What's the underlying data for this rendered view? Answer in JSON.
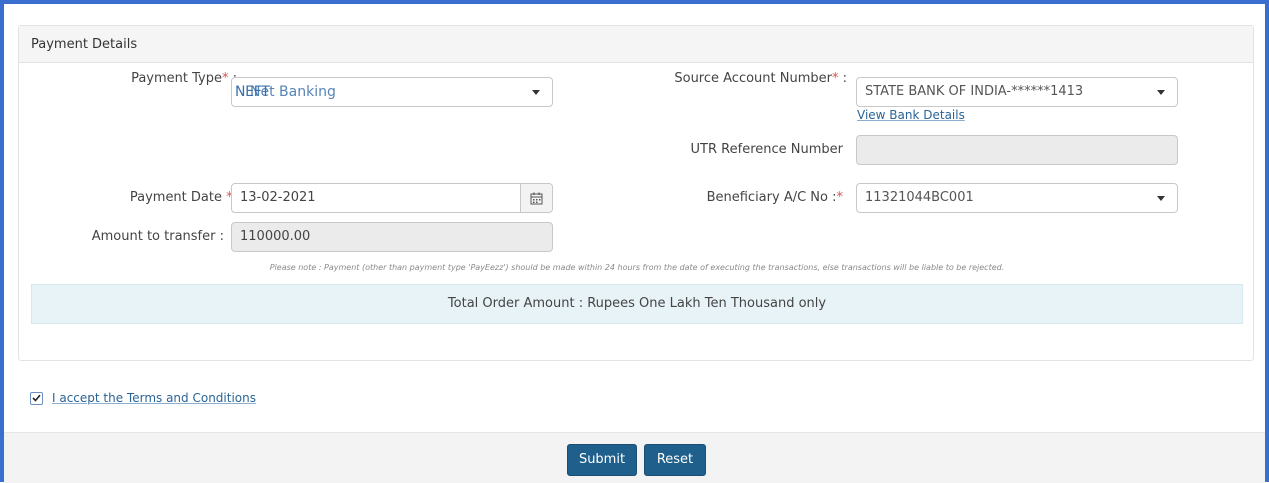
{
  "panel": {
    "title": "Payment Details",
    "payment_type": {
      "label": "Payment Type",
      "required_mark": "*",
      "colon": " :",
      "value": "NEFT",
      "overlay_text": "Net Banking"
    },
    "source_account": {
      "label": "Source Account Number",
      "required_mark": "*",
      "colon": " :",
      "value": "STATE BANK OF INDIA-******1413",
      "link": "View Bank Details"
    },
    "utr": {
      "label": "UTR Reference Number",
      "value": ""
    },
    "payment_date": {
      "label": "Payment Date ",
      "required_mark": "*",
      "colon": ":",
      "value": "13-02-2021",
      "icon": "calendar-icon"
    },
    "beneficiary": {
      "label": "Beneficiary A/C No :",
      "required_mark": "*",
      "value": "11321044BC001"
    },
    "amount": {
      "label": "Amount to transfer :",
      "value": "110000.00"
    },
    "note": "Please note : Payment (other than payment type 'PayEezz') should be made within 24 hours from the date of executing the transactions, else transactions will be liable to be rejected.",
    "total": "Total Order Amount : Rupees One Lakh Ten Thousand only"
  },
  "terms": {
    "label": "I accept the Terms and Conditions",
    "checked": true
  },
  "footer": {
    "submit_label": "Submit",
    "reset_label": "Reset"
  },
  "colors": {
    "frame": "#3a6fd0",
    "button": "#1f5f8b",
    "required": "#d9534f",
    "link": "#2a6496",
    "total_bg": "#e8f3f8"
  }
}
